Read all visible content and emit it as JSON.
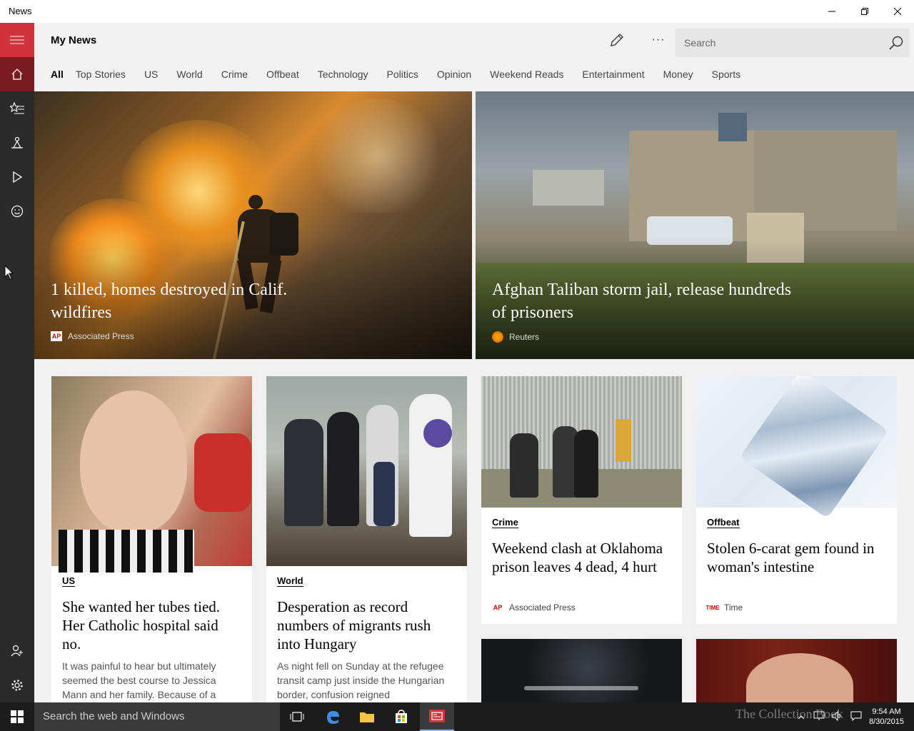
{
  "window": {
    "title": "News"
  },
  "header": {
    "page_title": "My News",
    "search_placeholder": "Search",
    "more_label": "···"
  },
  "categories": [
    "All",
    "Top Stories",
    "US",
    "World",
    "Crime",
    "Offbeat",
    "Technology",
    "Politics",
    "Opinion",
    "Weekend Reads",
    "Entertainment",
    "Money",
    "Sports"
  ],
  "active_category": "All",
  "hero": [
    {
      "headline": "1 killed, homes destroyed in Calif. wildfires",
      "source": "Associated Press",
      "source_logo": "AP"
    },
    {
      "headline": "Afghan Taliban storm jail, release hundreds of prisoners",
      "source": "Reuters",
      "source_logo": "reuters-logo"
    }
  ],
  "cards": [
    {
      "tag": "US",
      "title": "She wanted her tubes tied. Her Catholic hospital said no.",
      "summary": "It was painful to hear but ultimately seemed the best course to Jessica Mann and her family. Because of a"
    },
    {
      "tag": "World",
      "title": "Desperation as record numbers of migrants rush into Hungary",
      "summary": "As night fell on Sunday at the refugee transit camp just inside the Hungarian border, confusion reigned"
    },
    {
      "tag": "Crime",
      "title": "Weekend clash at Oklahoma prison leaves 4 dead, 4 hurt",
      "source": "Associated Press",
      "source_logo": "AP"
    },
    {
      "tag": "Offbeat",
      "title": "Stolen 6-carat gem found in woman's intestine",
      "source": "Time",
      "source_logo": "TIME"
    }
  ],
  "taskbar": {
    "search_placeholder": "Search the web and Windows",
    "time": "9:54 AM",
    "date": "8/30/2015"
  },
  "watermark": "The Collection Book",
  "colors": {
    "accent": "#d2323a",
    "sidebar": "#2b2b2b",
    "home_active": "#7a1b1f",
    "taskbar": "#1c1c1c"
  }
}
